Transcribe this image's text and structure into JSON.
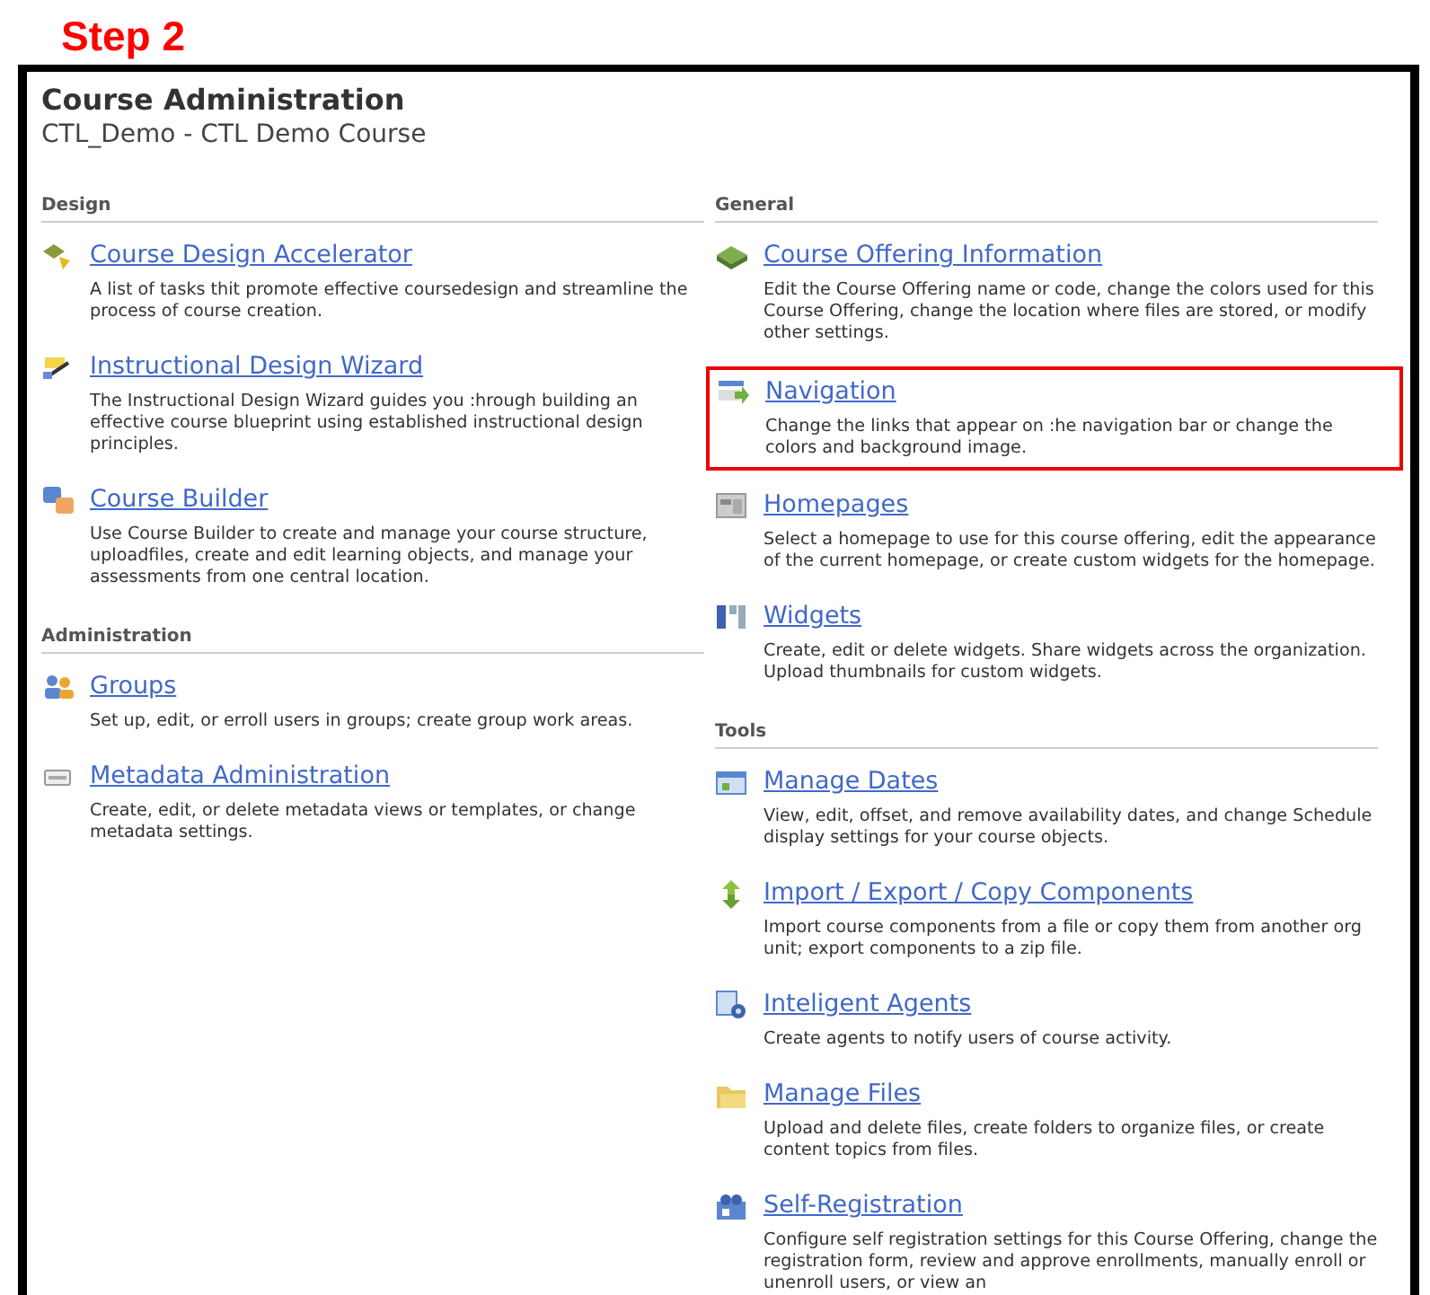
{
  "step_label": "Step 2",
  "page": {
    "title": "Course Administration",
    "subtitle": "CTL_Demo - CTL Demo Course"
  },
  "columns": [
    {
      "sections": [
        {
          "heading": "Design",
          "items": [
            {
              "link": "Course Design Accelerator",
              "description": "A list of tasks thit promote effective coursedesign and streamline the process of course creation.",
              "highlighted": false
            },
            {
              "link": "Instructional Design Wizard",
              "description": "The Instructional Design Wizard guides you :hrough building an effective course blueprint using established instructional design principles.",
              "highlighted": false
            },
            {
              "link": "Course Builder",
              "description": "Use Course Builder to create and manage your course structure, uploadfiles, create and edit learning objects, and manage your assessments from one central location.",
              "highlighted": false
            }
          ]
        },
        {
          "heading": "Administration",
          "items": [
            {
              "link": "Groups",
              "description": "Set up, edit, or erroll users in groups; create group work areas.",
              "highlighted": false
            },
            {
              "link": "Metadata Administration",
              "description": "Create, edit, or delete metadata views or templates, or change metadata settings.",
              "highlighted": false
            }
          ]
        }
      ]
    },
    {
      "sections": [
        {
          "heading": "General",
          "items": [
            {
              "link": "Course Offering Information",
              "description": "Edit the Course Offering name or code, change the colors used for this Course Offering, change the location where files are stored, or modify other settings.",
              "highlighted": false
            },
            {
              "link": "Navigation",
              "description": "Change the links that appear on :he navigation bar or change the colors and background image.",
              "highlighted": true
            },
            {
              "link": "Homepages",
              "description": "Select a homepage to use for this course offering, edit the appearance of the current homepage, or create custom widgets for the homepage.",
              "highlighted": false
            },
            {
              "link": "Widgets",
              "description": "Create, edit or delete widgets. Share widgets across the organization. Upload thumbnails for custom widgets.",
              "highlighted": false
            }
          ]
        },
        {
          "heading": "Tools",
          "items": [
            {
              "link": "Manage Dates",
              "description": "View, edit, offset, and remove availability dates, and change Schedule display settings for your course objects.",
              "highlighted": false
            },
            {
              "link": "Import / Export / Copy Components",
              "description": "Import course components from a file or copy them from another org unit; export components to a zip file.",
              "highlighted": false
            },
            {
              "link": "Inteligent Agents",
              "description": "Create agents to notify users of course activity.",
              "highlighted": false
            },
            {
              "link": "Manage Files",
              "description": "Upload and delete files, create folders to organize files, or create content topics from files.",
              "highlighted": false
            },
            {
              "link": "Self-Registration",
              "description": "Configure self registration settings for this Course Offering, change the registration form, review and approve enrollments, manually enroll or unenroll users, or view an",
              "highlighted": false
            }
          ]
        }
      ]
    }
  ]
}
